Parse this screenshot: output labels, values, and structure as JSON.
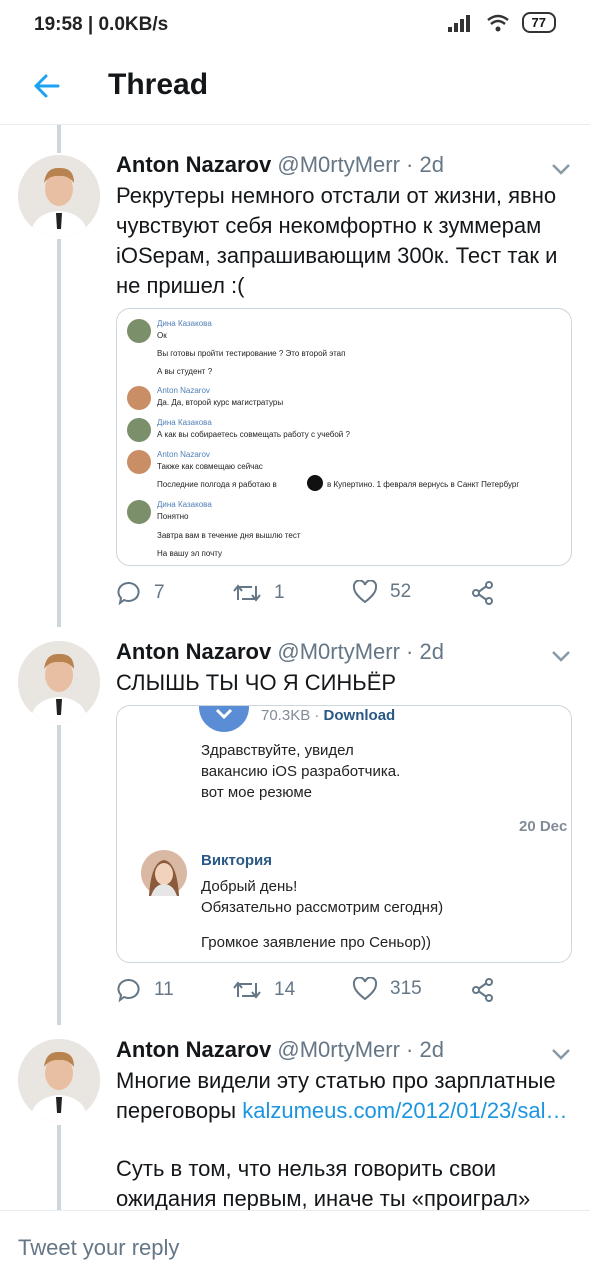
{
  "status_bar": {
    "time_net": "19:58 | 0.0KB/s",
    "battery": "77"
  },
  "app_bar": {
    "title": "Thread",
    "back_icon": "arrow-left-icon"
  },
  "colors": {
    "accent": "#1da1f2",
    "link": "#1b95e0",
    "muted": "#657786"
  },
  "tweets": [
    {
      "name": "Anton Nazarov",
      "handle": "@M0rtyMerr · 2d",
      "text": "Рекрутеры немного отстали от жизни, явно чувствуют себя некомфортно к зуммерам iOSерам, запрашивающим 300к. Тест так и не пришел :(",
      "media": {
        "messages": [
          {
            "author": "Дина Казакова",
            "lines": [
              "Ок",
              "Вы готовы пройти тестирование ? Это второй этап",
              "А вы студент ?"
            ]
          },
          {
            "author": "Anton Nazarov",
            "lines": [
              "Да. Да, второй курс магистратуры"
            ]
          },
          {
            "author": "Дина Казакова",
            "lines": [
              "А как вы собираетесь совмещать работу с учебой ?"
            ]
          },
          {
            "author": "Anton Nazarov",
            "lines": [
              "Также как совмещаю сейчас",
              "Последние полгода я работаю в",
              "в Купертино. 1 февраля вернусь в Санкт Петербург"
            ]
          },
          {
            "author": "Дина Казакова",
            "lines": [
              "Понятно",
              "Завтра вам в течение дня вышлю тест",
              "На вашу эл почту"
            ]
          }
        ]
      },
      "replies": "7",
      "retweets": "1",
      "likes": "52"
    },
    {
      "name": "Anton Nazarov",
      "handle": "@M0rtyMerr · 2d",
      "text": "СЛЫШЬ ТЫ ЧО Я СИНЬЁР",
      "media": {
        "file_size": "70.3KB · ",
        "download": "Download",
        "msg1": [
          "Здравствуйте, увидел",
          "вакансию iOS разработчика.",
          "вот мое резюме"
        ],
        "date": "20 Dec",
        "author": "Виктория",
        "msg2": [
          "Добрый день!",
          "Обязательно рассмотрим сегодня)"
        ],
        "msg3": "Громкое заявление про Сеньор))"
      },
      "replies": "11",
      "retweets": "14",
      "likes": "315"
    },
    {
      "name": "Anton Nazarov",
      "handle": "@M0rtyMerr · 2d",
      "text_a": "Многие видели эту статью про зарплатные переговоры ",
      "link": "kalzumeus.com/2012/01/23/sal…",
      "text_b": "Суть в том, что нельзя говорить свои ожидания первым, иначе ты «проиграл»"
    }
  ],
  "reply_placeholder": "Tweet your reply"
}
